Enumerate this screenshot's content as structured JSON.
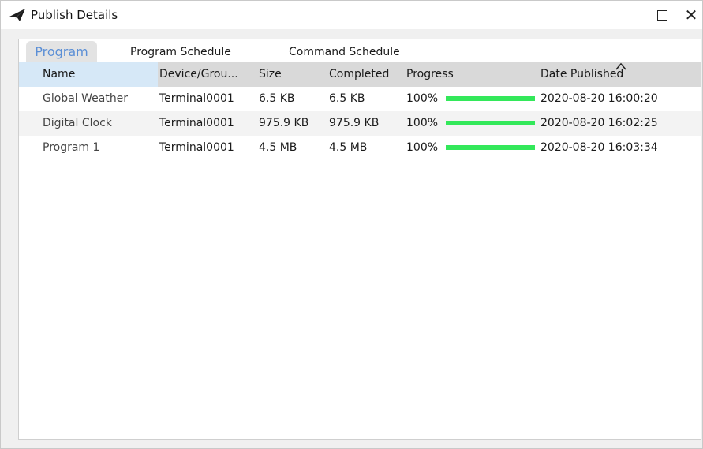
{
  "window": {
    "title": "Publish Details",
    "icon": "paper-plane-icon",
    "maximize_icon": "maximize-icon",
    "close_icon": "close-icon",
    "close_glyph": "✕"
  },
  "tabs": [
    {
      "label": "Program",
      "active": true
    },
    {
      "label": "Program Schedule",
      "active": false
    },
    {
      "label": "Command Schedule",
      "active": false
    }
  ],
  "table": {
    "columns": [
      "Name",
      "Device/Grou...",
      "Size",
      "Completed",
      "Progress",
      "Date Published"
    ],
    "sort_icon": "sort-ascending-icon",
    "rows": [
      {
        "name": "Global Weather",
        "device": "Terminal0001",
        "size": "6.5 KB",
        "completed": "6.5 KB",
        "progress_text": "100%",
        "progress": 1.0,
        "date": "2020-08-20 16:00:20"
      },
      {
        "name": "Digital Clock",
        "device": "Terminal0001",
        "size": "975.9 KB",
        "completed": "975.9 KB",
        "progress_text": "100%",
        "progress": 1.0,
        "date": "2020-08-20 16:02:25"
      },
      {
        "name": "Program 1",
        "device": "Terminal0001",
        "size": "4.5 MB",
        "completed": "4.5 MB",
        "progress_text": "100%",
        "progress": 1.0,
        "date": "2020-08-20 16:03:34"
      }
    ]
  },
  "colors": {
    "progress_fill": "#33e85a",
    "active_tab_text": "#5b8fd6",
    "selected_header_bg": "#d6e8f7"
  }
}
